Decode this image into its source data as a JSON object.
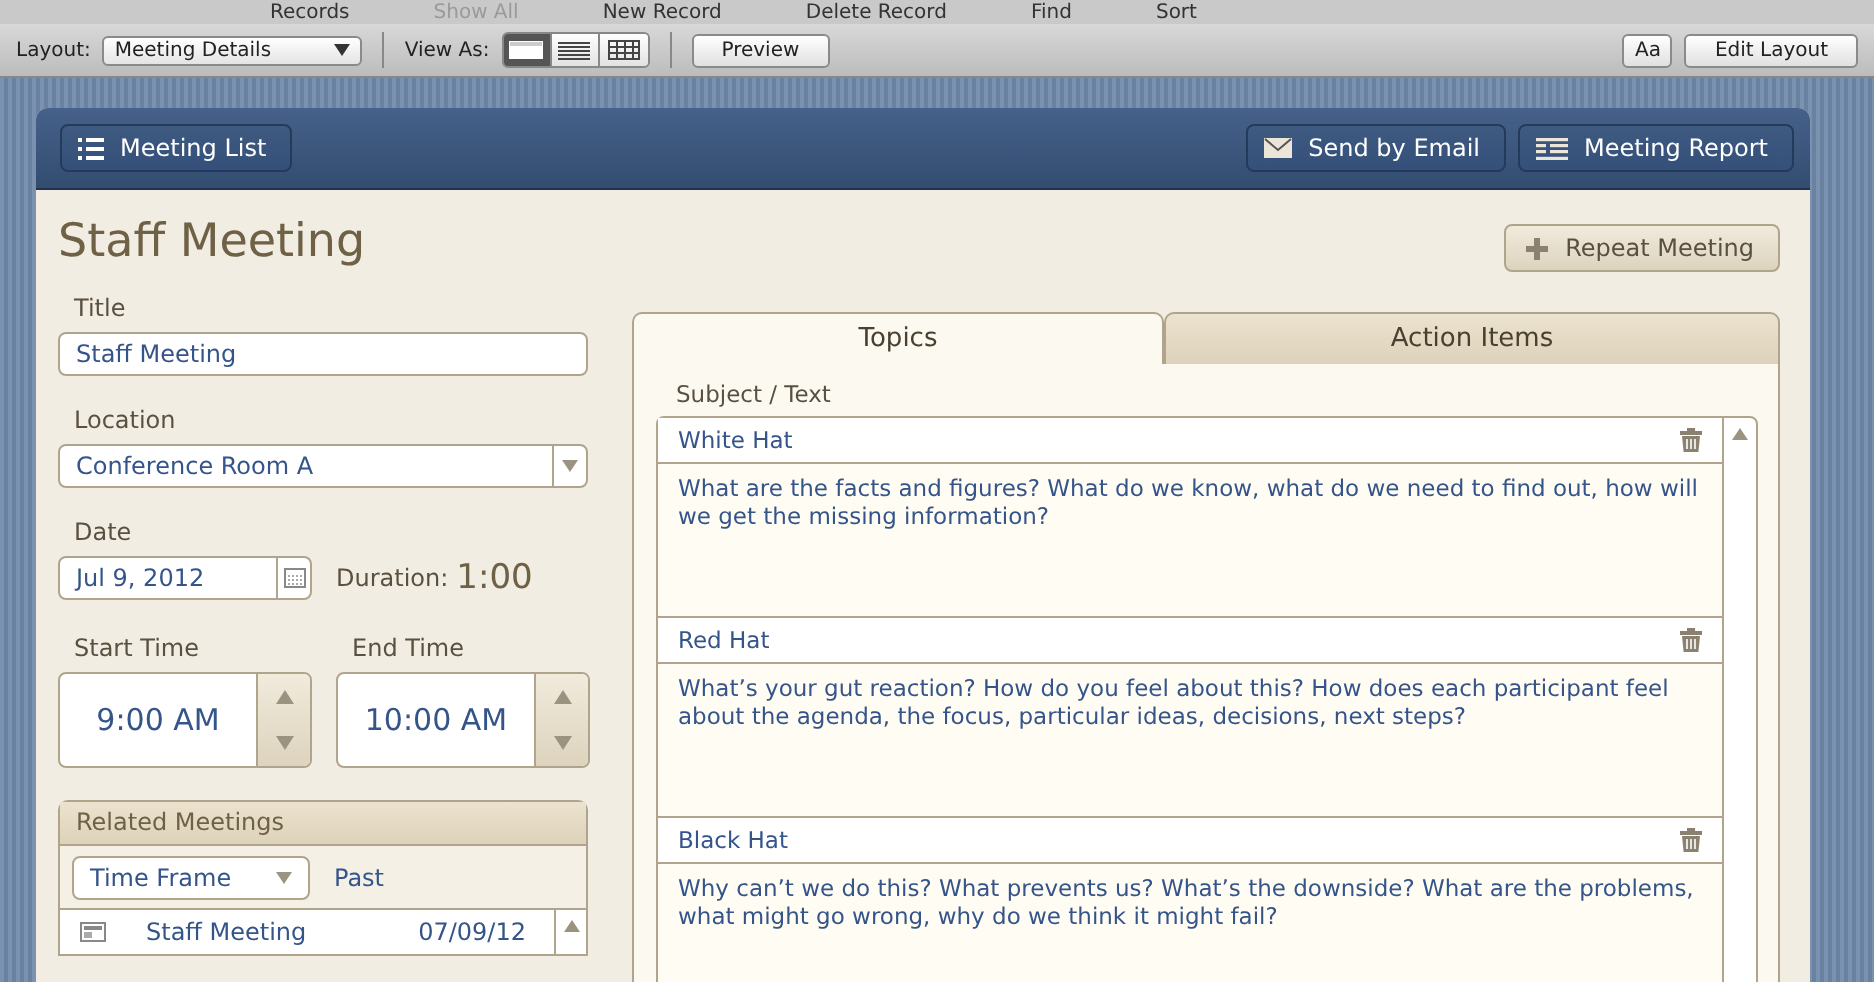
{
  "menu_strip": [
    {
      "label": "Records",
      "disabled": false
    },
    {
      "label": "Show All",
      "disabled": true
    },
    {
      "label": "New Record",
      "disabled": false
    },
    {
      "label": "Delete Record",
      "disabled": false
    },
    {
      "label": "Find",
      "disabled": false
    },
    {
      "label": "Sort",
      "disabled": false
    }
  ],
  "toolbar": {
    "layout_label": "Layout:",
    "layout_value": "Meeting Details",
    "view_as_label": "View As:",
    "view_modes": [
      {
        "kind": "form",
        "selected": true
      },
      {
        "kind": "list",
        "selected": false
      },
      {
        "kind": "table",
        "selected": false
      }
    ],
    "preview_button": "Preview",
    "text_button": "Aa",
    "edit_layout_button": "Edit Layout"
  },
  "header": {
    "meeting_list_button": "Meeting List",
    "email_button": "Send by Email",
    "report_button": "Meeting Report"
  },
  "record": {
    "heading": "Staff Meeting",
    "repeat_button": "Repeat Meeting",
    "title_label": "Title",
    "title_value": "Staff Meeting",
    "location_label": "Location",
    "location_value": "Conference Room A",
    "date_label": "Date",
    "date_value": "Jul 9, 2012",
    "duration_label": "Duration:",
    "duration_value": "1:00",
    "start_label": "Start Time",
    "start_value": "9:00 AM",
    "end_label": "End Time",
    "end_value": "10:00 AM"
  },
  "related": {
    "title": "Related Meetings",
    "filter_value": "Time Frame",
    "filter_text": "Past",
    "rows": [
      {
        "name": "Staff Meeting",
        "date": "07/09/12"
      }
    ]
  },
  "tabs": [
    {
      "label": "Topics",
      "selected": true
    },
    {
      "label": "Action Items",
      "selected": false
    }
  ],
  "topics_header": "Subject / Text",
  "topics": [
    {
      "subject": "White Hat",
      "text": "What are the facts and figures? What do we know, what do we need to find out, how will we get the missing information?"
    },
    {
      "subject": "Red Hat",
      "text": "What’s your gut reaction?  How do you feel about this? How does each participant feel about the agenda, the focus, particular ideas, decisions, next steps?"
    },
    {
      "subject": "Black Hat",
      "text": "Why can’t we do this?  What prevents us?  What’s the downside? What are the problems, what might go wrong, why do we think it might fail?"
    }
  ]
}
